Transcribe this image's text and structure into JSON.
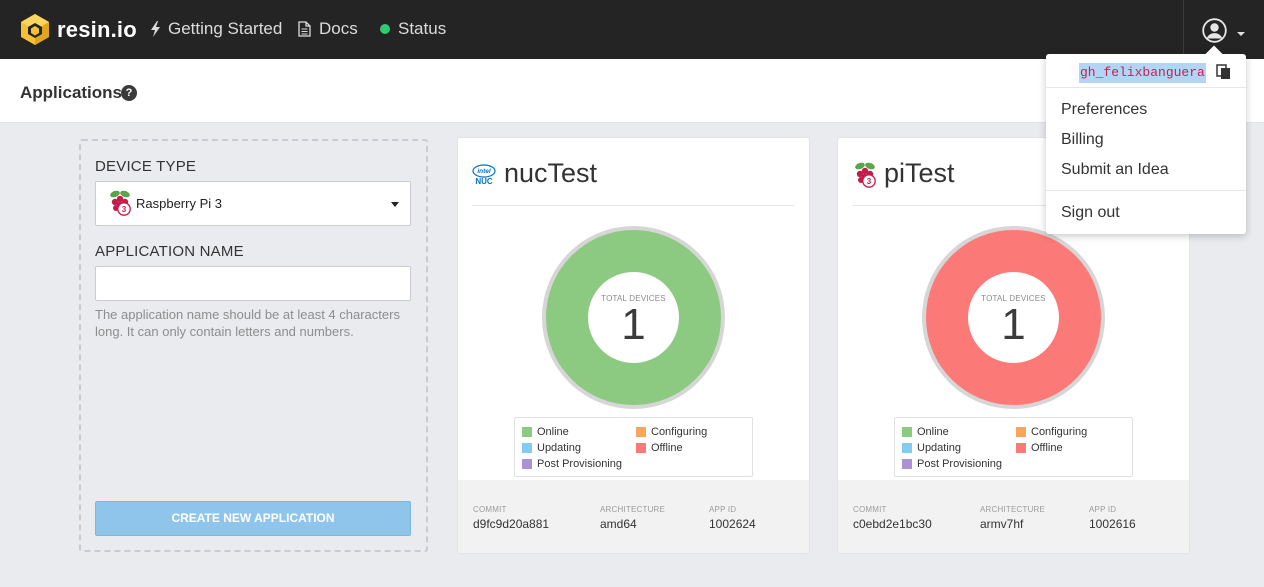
{
  "navbar": {
    "brand": "resin.io",
    "getting_started": "Getting Started",
    "docs": "Docs",
    "status": "Status",
    "status_color": "#2ecc71"
  },
  "subheader": {
    "title": "Applications"
  },
  "create_form": {
    "device_type_label": "DEVICE TYPE",
    "device_type_value": "Raspberry Pi 3",
    "app_name_label": "APPLICATION NAME",
    "app_name_value": "",
    "help_text": "The application name should be at least 4 characters long. It can only contain letters and numbers.",
    "create_button": "CREATE NEW APPLICATION"
  },
  "apps": [
    {
      "name": "nucTest",
      "logo_icon": "intel-nuc-icon",
      "donut_caption": "TOTAL DEVICES",
      "total_devices": "1",
      "donut_color": "#8cc981",
      "commit_label": "COMMIT",
      "commit": "d9fc9d20a881",
      "arch_label": "ARCHITECTURE",
      "architecture": "amd64",
      "appid_label": "APP ID",
      "app_id": "1002624"
    },
    {
      "name": "piTest",
      "logo_icon": "raspberry-pi-icon",
      "donut_caption": "TOTAL DEVICES",
      "total_devices": "1",
      "donut_color": "#fb7977",
      "commit_label": "COMMIT",
      "commit": "c0ebd2e1bc30",
      "arch_label": "ARCHITECTURE",
      "architecture": "armv7hf",
      "appid_label": "APP ID",
      "app_id": "1002616"
    }
  ],
  "legend": {
    "online": "Online",
    "configuring": "Configuring",
    "updating": "Updating",
    "offline": "Offline",
    "post_provisioning": "Post Provisioning",
    "colors": {
      "online": "#8cc981",
      "configuring": "#f8a65b",
      "updating": "#82cbf2",
      "offline": "#fb7977",
      "post_provisioning": "#a992d6"
    }
  },
  "user_menu": {
    "username": "gh_felixbanguera",
    "preferences": "Preferences",
    "billing": "Billing",
    "submit_idea": "Submit an Idea",
    "sign_out": "Sign out"
  }
}
